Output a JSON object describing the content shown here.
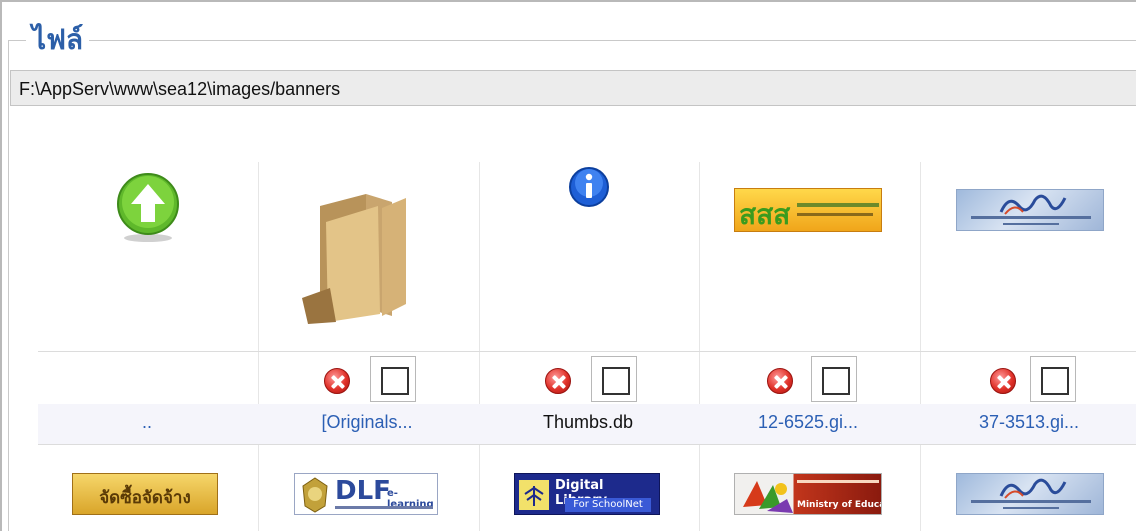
{
  "legend": "ไฟล์",
  "path": "F:\\AppServ\\www\\sea12\\images/banners",
  "items": [
    {
      "name": "..",
      "icon": "up-arrow-icon"
    },
    {
      "name": "[Originals...",
      "icon": "folder-icon"
    },
    {
      "name": "Thumbs.db",
      "icon": "info-icon"
    },
    {
      "name": "12-6525.gi...",
      "icon": "banner-thumbnail"
    },
    {
      "name": "37-3513.gi...",
      "icon": "banner-thumbnail"
    }
  ],
  "row2_banners": [
    {
      "text": "จัดซื้อจัดจ้าง"
    },
    {
      "text": "DLF",
      "subtext": "e-learning"
    },
    {
      "text": "Digital Library",
      "subtext": "For SchoolNet"
    },
    {
      "text": "Ministry of Education"
    },
    {
      "text": ""
    }
  ],
  "colors": {
    "accent": "#2c5fa8",
    "link": "#2b5fb4"
  }
}
